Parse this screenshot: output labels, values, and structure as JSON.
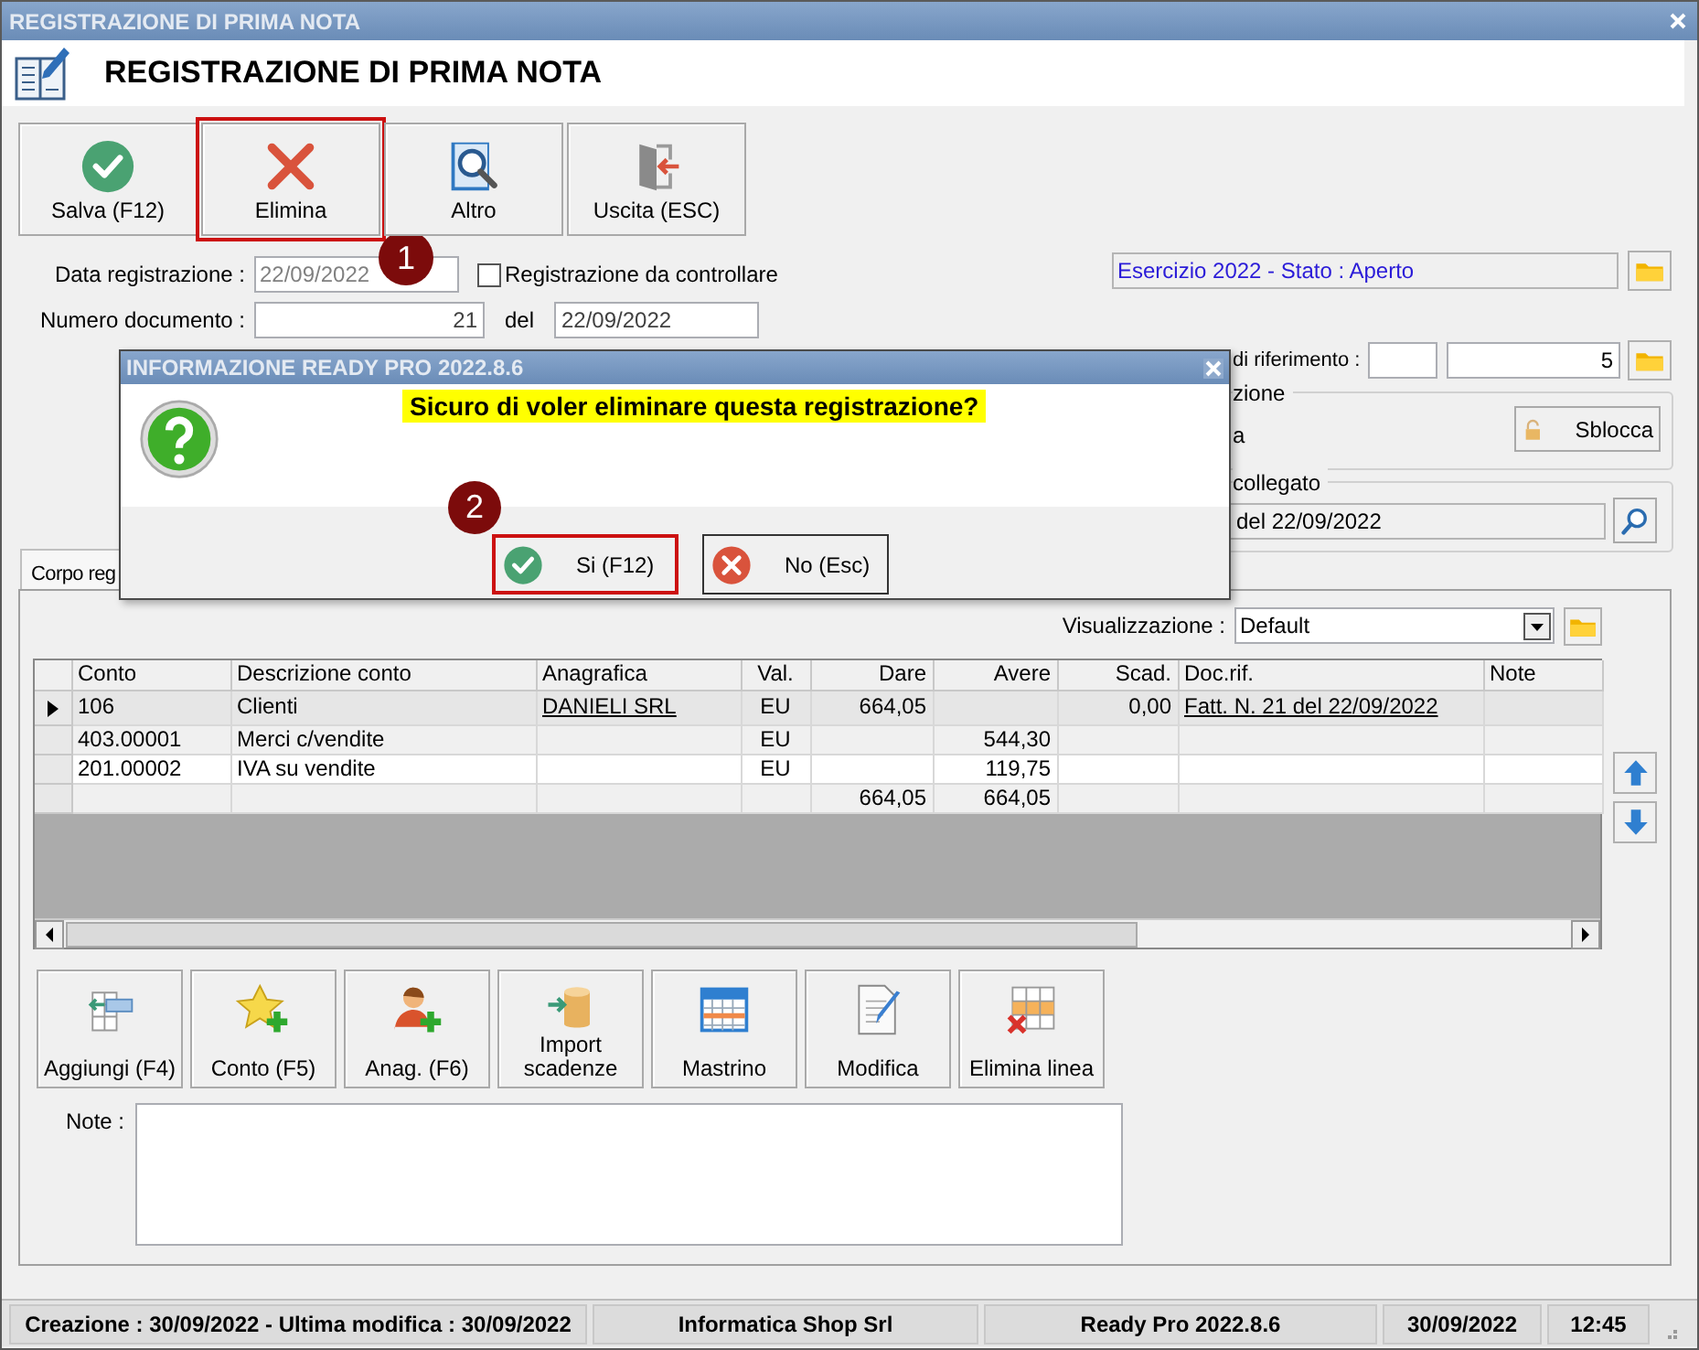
{
  "window": {
    "title": "REGISTRAZIONE DI PRIMA NOTA"
  },
  "header": {
    "title": "REGISTRAZIONE DI PRIMA NOTA"
  },
  "toolbar": [
    {
      "label": "Salva (F12)",
      "highlighted": false
    },
    {
      "label": "Elimina",
      "highlighted": true,
      "badge": "1"
    },
    {
      "label": "Altro",
      "highlighted": false
    },
    {
      "label": "Uscita (ESC)",
      "highlighted": false
    }
  ],
  "form": {
    "data_registrazione": {
      "label": "Data registrazione :",
      "value": "22/09/2022",
      "disabled": true
    },
    "da_controllare": {
      "label": "Registrazione da controllare",
      "checked": false
    },
    "numero_documento": {
      "label": "Numero documento :",
      "value": "21"
    },
    "del": {
      "label": "del",
      "value": "22/09/2022"
    },
    "esercizio": {
      "value": "Esercizio 2022 - Stato : Aperto"
    },
    "riferimento": {
      "label": "di riferimento :",
      "value": "5"
    },
    "group_1": {
      "legend": "zione",
      "text": "a",
      "button": "Sblocca"
    },
    "group_2": {
      "legend": "collegato",
      "value": "del 22/09/2022"
    }
  },
  "tab": {
    "label": "Corpo reg",
    "selected": true
  },
  "visualizzazione": {
    "label": "Visualizzazione :",
    "value": "Default"
  },
  "table": {
    "columns": [
      {
        "label": "Conto",
        "kind": "text"
      },
      {
        "label": "Descrizione conto",
        "kind": "text"
      },
      {
        "label": "Anagrafica",
        "kind": "link"
      },
      {
        "label": "Val.",
        "kind": "center"
      },
      {
        "label": "Dare",
        "kind": "number"
      },
      {
        "label": "Avere",
        "kind": "number"
      },
      {
        "label": "Scad.",
        "kind": "number"
      },
      {
        "label": "Doc.rif.",
        "kind": "link"
      },
      {
        "label": "Note",
        "kind": "text"
      }
    ],
    "rows": [
      {
        "selected": true,
        "cells": [
          "106",
          "Clienti",
          "DANIELI SRL",
          "EU",
          "664,05",
          null,
          "0,00",
          "Fatt. N. 21 del 22/09/2022",
          null
        ]
      },
      {
        "selected": false,
        "cells": [
          "403.00001",
          "Merci c/vendite",
          null,
          "EU",
          null,
          "544,30",
          null,
          null,
          null
        ]
      },
      {
        "selected": false,
        "cells": [
          "201.00002",
          "IVA su vendite",
          null,
          "EU",
          null,
          "119,75",
          null,
          null,
          null
        ]
      },
      {
        "selected": false,
        "cells": [
          null,
          null,
          null,
          null,
          "664,05",
          "664,05",
          null,
          null,
          null
        ]
      }
    ]
  },
  "actions": [
    "Aggiungi (F4)",
    "Conto (F5)",
    "Anag. (F6)",
    "Import scadenze",
    "Mastrino",
    "Modifica",
    "Elimina linea"
  ],
  "note": {
    "label": "Note :"
  },
  "dialog": {
    "title": "INFORMAZIONE READY PRO 2022.8.6",
    "message": "Sicuro di voler eliminare questa registrazione?",
    "buttons": [
      {
        "label": "Si (F12)",
        "highlighted": true,
        "badge": "2"
      },
      {
        "label": "No (Esc)",
        "highlighted": false
      }
    ]
  },
  "status_bar": [
    "Creazione : 30/09/2022 - Ultima modifica : 30/09/2022",
    "Informatica Shop Srl",
    "Ready Pro 2022.8.6",
    "30/09/2022",
    "12:45"
  ]
}
